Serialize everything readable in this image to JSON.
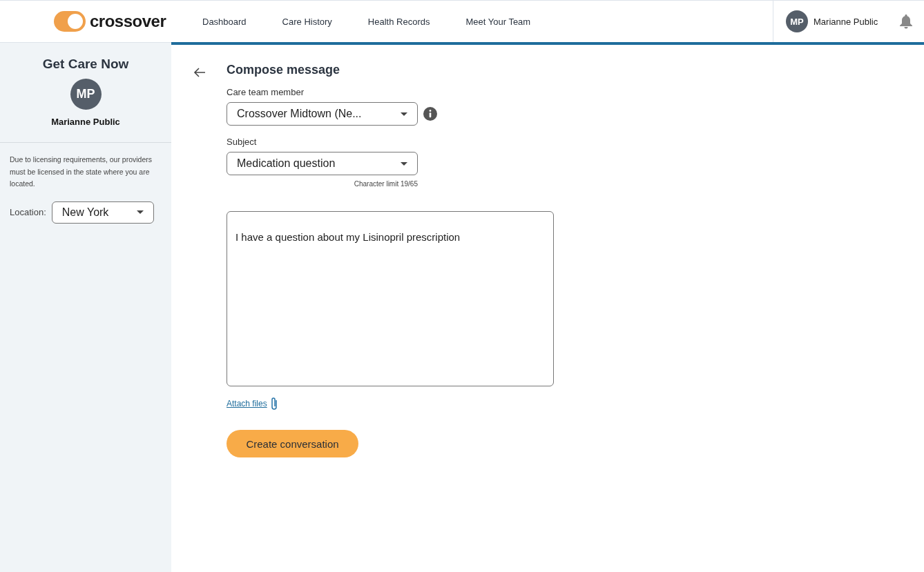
{
  "header": {
    "logo": "crossover",
    "nav": [
      "Dashboard",
      "Care History",
      "Health Records",
      "Meet Your Team"
    ],
    "user": {
      "initials": "MP",
      "name": "Marianne Public"
    }
  },
  "sidebar": {
    "title": "Get Care Now",
    "initials": "MP",
    "name": "Marianne Public",
    "notice": "Due to licensing requirements, our providers must be licensed in the state where you are located.",
    "location_label": "Location:",
    "location": "New York"
  },
  "compose": {
    "title": "Compose message",
    "care_team_label": "Care team member",
    "care_team": "Crossover Midtown (Ne...",
    "subject_label": "Subject",
    "subject": "Medication question",
    "char_limit": "Character limit 19/65",
    "message": "I have a question about my Lisinopril prescription",
    "attach": "Attach files",
    "submit": "Create conversation"
  }
}
